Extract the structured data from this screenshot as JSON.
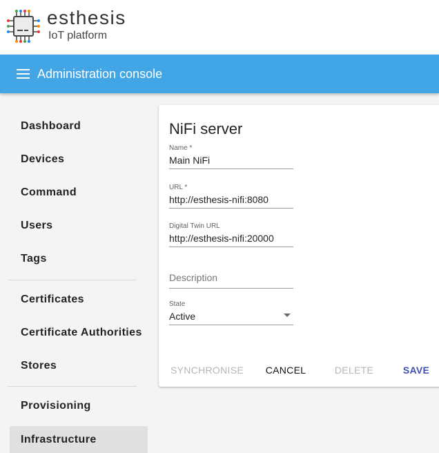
{
  "brand": {
    "name": "esthesis",
    "subtitle": "IoT platform"
  },
  "toolbar": {
    "title": "Administration console",
    "menu_icon": "menu-icon"
  },
  "sidebar": {
    "items": [
      {
        "label": "Dashboard"
      },
      {
        "label": "Devices"
      },
      {
        "label": "Command"
      },
      {
        "label": "Users"
      },
      {
        "label": "Tags"
      },
      {
        "label": "Certificates"
      },
      {
        "label": "Certificate Authorities"
      },
      {
        "label": "Stores"
      },
      {
        "label": "Provisioning"
      },
      {
        "label": "Infrastructure",
        "active": true
      }
    ]
  },
  "form": {
    "title": "NiFi server",
    "name": {
      "label": "Name *",
      "value": "Main NiFi"
    },
    "url": {
      "label": "URL *",
      "value": "http://esthesis-nifi:8080"
    },
    "twin_url": {
      "label": "Digital Twin URL",
      "value": "http://esthesis-nifi:20000"
    },
    "description": {
      "placeholder": "Description"
    },
    "state": {
      "label": "State",
      "value": "Active"
    }
  },
  "actions": {
    "synchronise": "SYNCHRONISE",
    "cancel": "CANCEL",
    "delete": "DELETE",
    "save": "SAVE"
  },
  "colors": {
    "toolbar": "#42a5e6",
    "primary": "#3f51b5",
    "active_nav": "#e0e0e0"
  }
}
